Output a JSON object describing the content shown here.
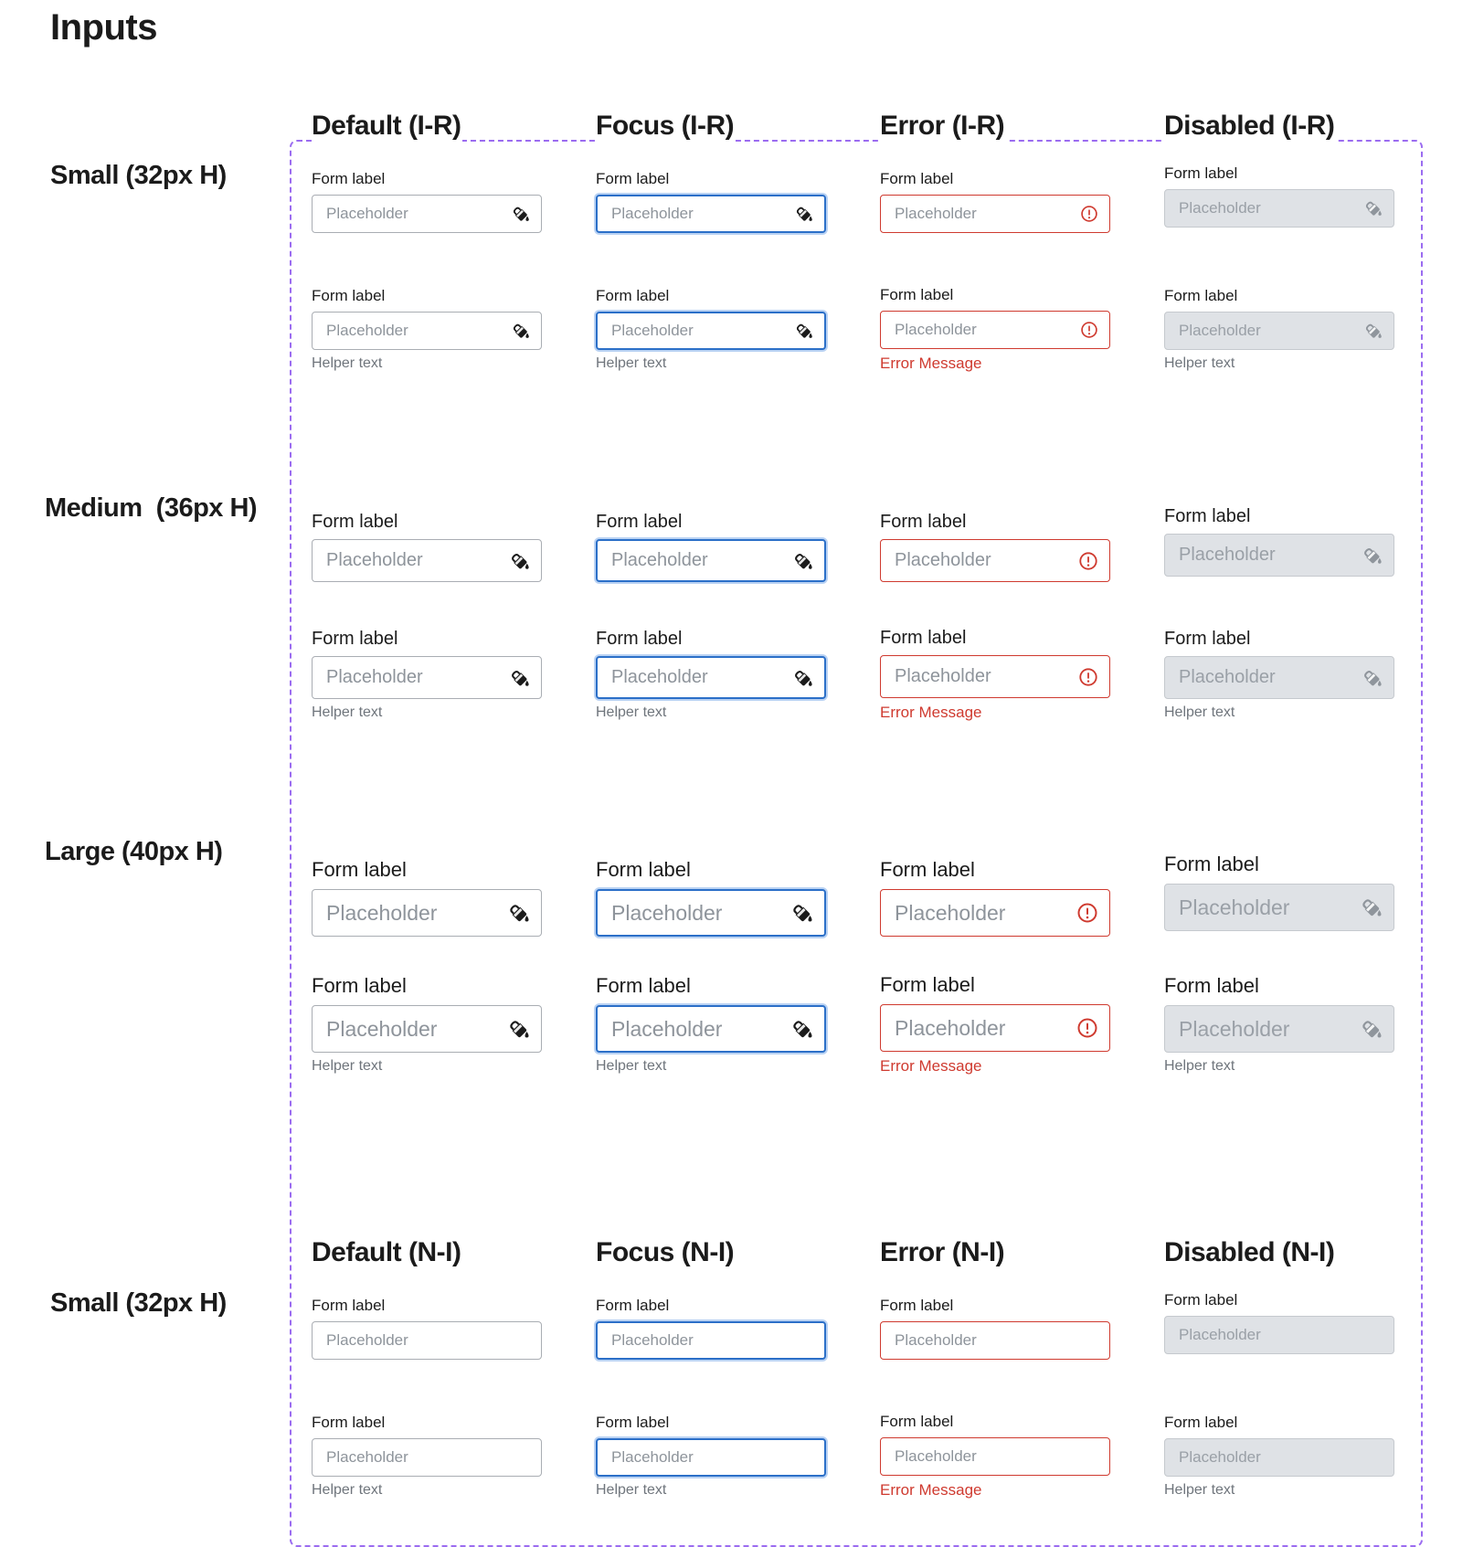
{
  "page": {
    "title": "Inputs"
  },
  "common": {
    "form_label": "Form label",
    "placeholder": "Placeholder",
    "helper_text": "Helper text",
    "error_message": "Error Message"
  },
  "sections": {
    "ir": {
      "headers": [
        "Default (I-R)",
        "Focus (I-R)",
        "Error (I-R)",
        "Disabled (I-R)"
      ],
      "rows": [
        "Small (32px H)",
        "Medium  (36px H)",
        "Large (40px H)"
      ]
    },
    "ni": {
      "headers": [
        "Default (N-I)",
        "Focus (N-I)",
        "Error (N-I)",
        "Disabled (N-I)"
      ],
      "rows": [
        "Small (32px H)"
      ]
    }
  },
  "icons": {
    "default": "paint-bucket-icon",
    "error": "error-circle-icon",
    "disabled": "paint-bucket-icon"
  },
  "colors": {
    "focus_border": "#2b6fc8",
    "error": "#cf3a2f",
    "disabled_fill": "#dfe2e6",
    "frame_dash": "#9b6cf0"
  }
}
